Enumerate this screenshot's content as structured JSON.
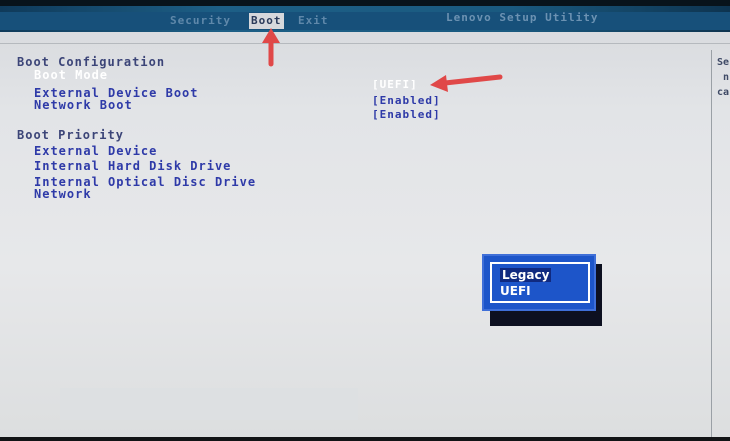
{
  "tabs": [
    {
      "label": "Security"
    },
    {
      "label": "Boot"
    },
    {
      "label": "Exit"
    }
  ],
  "utility_title": "Lenovo Setup Utility",
  "boot_configuration": {
    "heading": "Boot Configuration",
    "items": [
      {
        "label": "Boot Mode",
        "value": "[UEFI]"
      },
      {
        "label": "External Device Boot",
        "value": "[Enabled]"
      },
      {
        "label": "Network Boot",
        "value": "[Enabled]"
      }
    ]
  },
  "boot_priority": {
    "heading": "Boot Priority",
    "items": [
      {
        "label": "External Device"
      },
      {
        "label": "Internal Hard Disk Drive"
      },
      {
        "label": "Internal Optical Disc Drive"
      },
      {
        "label": "Network"
      }
    ]
  },
  "help_text": "Se\n n\nca",
  "popup": {
    "options": [
      {
        "label": "Legacy"
      },
      {
        "label": "UEFI"
      }
    ]
  },
  "colors": {
    "accent": "#1d55c9",
    "arrow": "#e04848",
    "item_text": "#2e3aa8"
  },
  "icons": [
    "arrow-up-icon",
    "arrow-left-icon"
  ]
}
